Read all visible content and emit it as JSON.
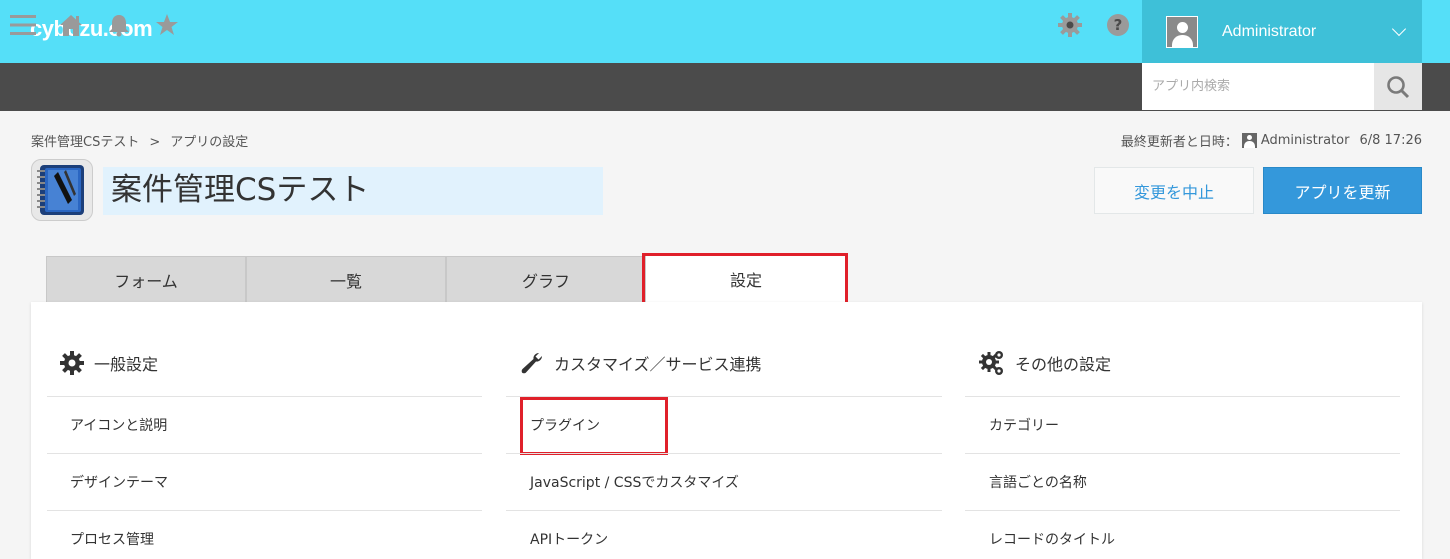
{
  "header": {
    "logo": "cybozu.com",
    "user_name": "Administrator"
  },
  "toolbar": {
    "search_placeholder": "アプリ内検索"
  },
  "breadcrumb": {
    "app": "案件管理CSテスト",
    "separator": ">",
    "current": "アプリの設定"
  },
  "meta": {
    "label": "最終更新者と日時：",
    "user": "Administrator",
    "datetime": "6/8 17:26"
  },
  "app": {
    "title": "案件管理CSテスト"
  },
  "actions": {
    "cancel": "変更を中止",
    "update": "アプリを更新"
  },
  "tabs": [
    {
      "label": "フォーム"
    },
    {
      "label": "一覧"
    },
    {
      "label": "グラフ"
    },
    {
      "label": "設定"
    }
  ],
  "columns": [
    {
      "title": "一般設定",
      "items": [
        "アイコンと説明",
        "デザインテーマ",
        "プロセス管理"
      ]
    },
    {
      "title": "カスタマイズ／サービス連携",
      "items": [
        "プラグイン",
        "JavaScript / CSSでカスタマイズ",
        "APIトークン"
      ]
    },
    {
      "title": "その他の設定",
      "items": [
        "カテゴリー",
        "言語ごとの名称",
        "レコードのタイトル"
      ]
    }
  ],
  "colors": {
    "header_bg": "#55dff8",
    "toolbar_bg": "#4b4b4b",
    "primary": "#3498db",
    "highlight": "#e0202a"
  }
}
